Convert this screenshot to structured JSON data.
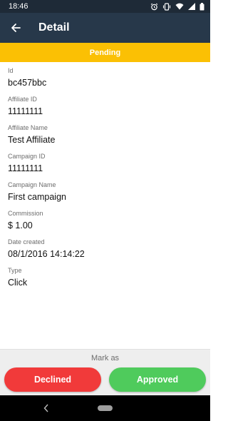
{
  "status_bar": {
    "time": "18:46"
  },
  "app_bar": {
    "title": "Detail"
  },
  "status_banner": {
    "text": "Pending",
    "color": "#fbc004"
  },
  "fields": [
    {
      "label": "Id",
      "value": "bc457bbc"
    },
    {
      "label": "Affiliate ID",
      "value": "11111111"
    },
    {
      "label": "Affiliate Name",
      "value": "Test Affiliate"
    },
    {
      "label": "Campaign ID",
      "value": "11111111"
    },
    {
      "label": "Campaign Name",
      "value": "First campaign"
    },
    {
      "label": "Commission",
      "value": "$ 1.00"
    },
    {
      "label": "Date created",
      "value": "08/1/2016 14:14:22"
    },
    {
      "label": "Type",
      "value": "Click"
    }
  ],
  "footer": {
    "mark_as": "Mark as",
    "decline_label": "Declined",
    "approve_label": "Approved"
  },
  "colors": {
    "app_bar": "#27384a",
    "decline": "#f13a3a",
    "approve": "#4fcb5c"
  },
  "icons": {
    "back": "arrow-left-icon",
    "alarm": "alarm-icon",
    "vibrate": "vibrate-icon",
    "wifi": "wifi-icon",
    "signal": "signal-icon",
    "battery": "battery-icon",
    "nav_back": "nav-back-icon",
    "nav_home": "nav-home-pill"
  }
}
